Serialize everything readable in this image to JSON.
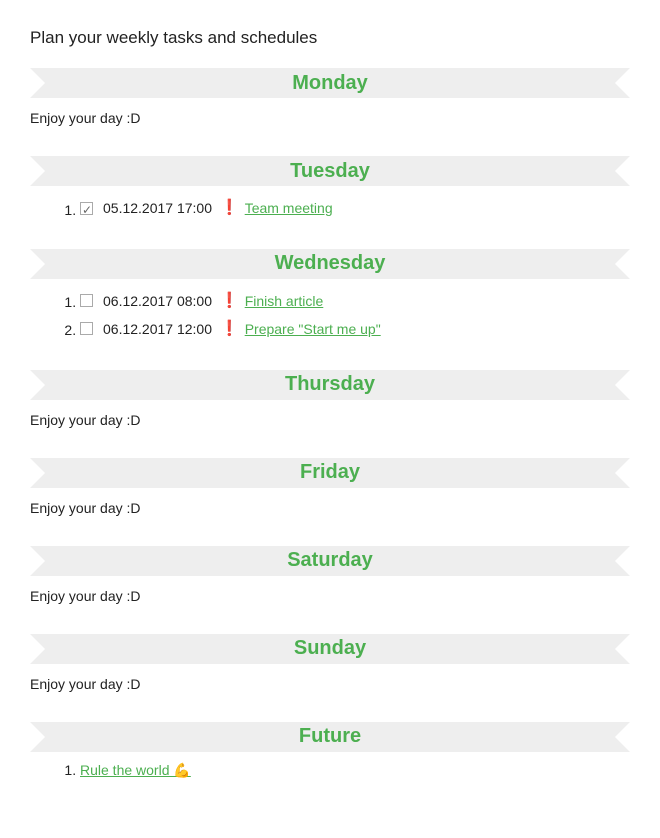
{
  "title": "Plan your weekly tasks and schedules",
  "empty_text": "Enjoy your day :D",
  "days": {
    "monday": {
      "label": "Monday",
      "tasks": []
    },
    "tuesday": {
      "label": "Tuesday",
      "tasks": [
        {
          "checked": true,
          "datetime": "05.12.2017 17:00",
          "important": true,
          "title": "Team meeting"
        }
      ]
    },
    "wednesday": {
      "label": "Wednesday",
      "tasks": [
        {
          "checked": false,
          "datetime": "06.12.2017 08:00",
          "important": true,
          "title": "Finish article"
        },
        {
          "checked": false,
          "datetime": "06.12.2017 12:00",
          "important": true,
          "title": "Prepare \"Start me up\""
        }
      ]
    },
    "thursday": {
      "label": "Thursday",
      "tasks": []
    },
    "friday": {
      "label": "Friday",
      "tasks": []
    },
    "saturday": {
      "label": "Saturday",
      "tasks": []
    },
    "sunday": {
      "label": "Sunday",
      "tasks": []
    }
  },
  "future": {
    "label": "Future",
    "items": [
      {
        "title": "Rule the world 💪"
      }
    ]
  }
}
